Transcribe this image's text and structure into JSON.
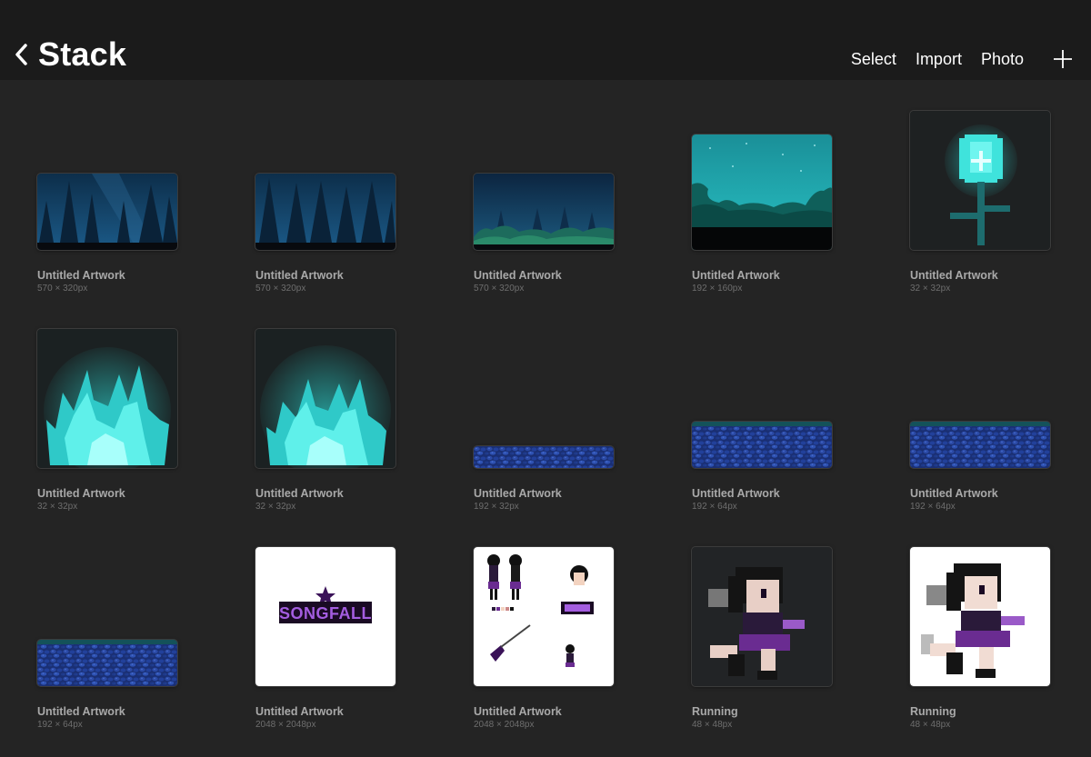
{
  "header": {
    "title": "Stack",
    "actions": {
      "select": "Select",
      "import": "Import",
      "photo": "Photo"
    }
  },
  "artworks": [
    {
      "name": "Untitled Artwork",
      "size": "570 × 320px"
    },
    {
      "name": "Untitled Artwork",
      "size": "570 × 320px"
    },
    {
      "name": "Untitled Artwork",
      "size": "570 × 320px"
    },
    {
      "name": "Untitled Artwork",
      "size": "192 × 160px"
    },
    {
      "name": "Untitled Artwork",
      "size": "32 × 32px"
    },
    {
      "name": "Untitled Artwork",
      "size": "32 × 32px"
    },
    {
      "name": "Untitled Artwork",
      "size": "32 × 32px"
    },
    {
      "name": "Untitled Artwork",
      "size": "192 × 32px"
    },
    {
      "name": "Untitled Artwork",
      "size": "192 × 64px"
    },
    {
      "name": "Untitled Artwork",
      "size": "192 × 64px"
    },
    {
      "name": "Untitled Artwork",
      "size": "192 × 64px"
    },
    {
      "name": "Untitled Artwork",
      "size": "2048 × 2048px"
    },
    {
      "name": "Untitled Artwork",
      "size": "2048 × 2048px"
    },
    {
      "name": "Running",
      "size": "48 × 48px"
    },
    {
      "name": "Running",
      "size": "48 × 48px"
    }
  ],
  "logo_text": "SONGFALL",
  "colors": {
    "background": "#242424",
    "header": "#1b1b1b",
    "label": "#a9a9a9",
    "teal": "#2ee6e0",
    "purple": "#6a2c91"
  }
}
